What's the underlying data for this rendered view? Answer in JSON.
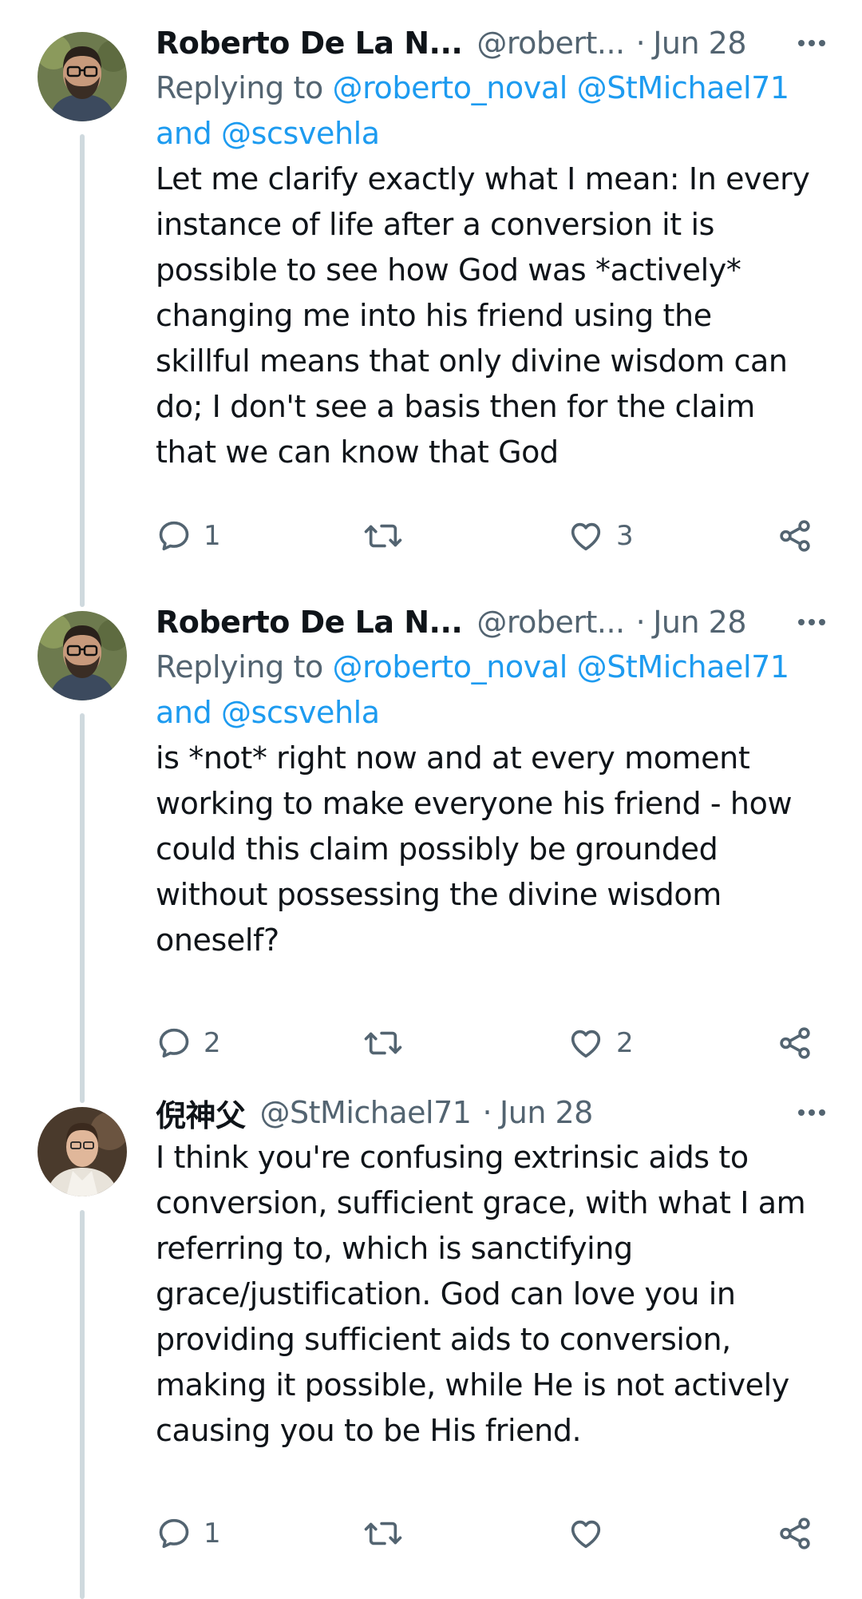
{
  "tweets": [
    {
      "author_name": "Roberto De La N...",
      "handle": "@robert...",
      "dot": "·",
      "date": "Jun 28",
      "replying_prefix": "Replying to",
      "mention1": "@roberto_noval",
      "mention2": "@StMichael71",
      "and_text": "and",
      "mention3": "@scsvehla",
      "text": "Let me clarify exactly what I mean: In every\ninstance of life after a conversion it is\npossible to see how God was *actively*\nchanging me into his friend using the\nskillful means that only divine wisdom can\ndo; I don't see a basis then for the claim\nthat we can know that God",
      "reply_count": "1",
      "retweet_count": "",
      "like_count": "3"
    },
    {
      "author_name": "Roberto De La N...",
      "handle": "@robert...",
      "dot": "·",
      "date": "Jun 28",
      "replying_prefix": "Replying to",
      "mention1": "@roberto_noval",
      "mention2": "@StMichael71",
      "and_text": "and",
      "mention3": "@scsvehla",
      "text": "is *not* right now and at every moment\nworking to make everyone his friend - how\ncould this claim possibly be grounded\nwithout possessing the divine wisdom\noneself?",
      "reply_count": "2",
      "retweet_count": "",
      "like_count": "2"
    },
    {
      "author_name": "倪神父",
      "handle": "@StMichael71",
      "dot": "·",
      "date": "Jun 28",
      "text": "I think you're confusing extrinsic aids to\nconversion, sufficient grace, with what I am\nreferring to, which is sanctifying\ngrace/justification. God can love you in\nproviding sufficient aids to conversion,\nmaking it possible, while He is not actively\ncausing you to be His friend.",
      "reply_count": "1",
      "retweet_count": "",
      "like_count": ""
    }
  ],
  "icons": {
    "reply": "reply-icon",
    "retweet": "retweet-icon",
    "like": "heart-icon",
    "share": "share-icon",
    "more": "more-options-icon"
  },
  "colors": {
    "text": "#0f1419",
    "secondary": "#536471",
    "link": "#1d9bf0",
    "thread_line": "#cfd9de"
  }
}
